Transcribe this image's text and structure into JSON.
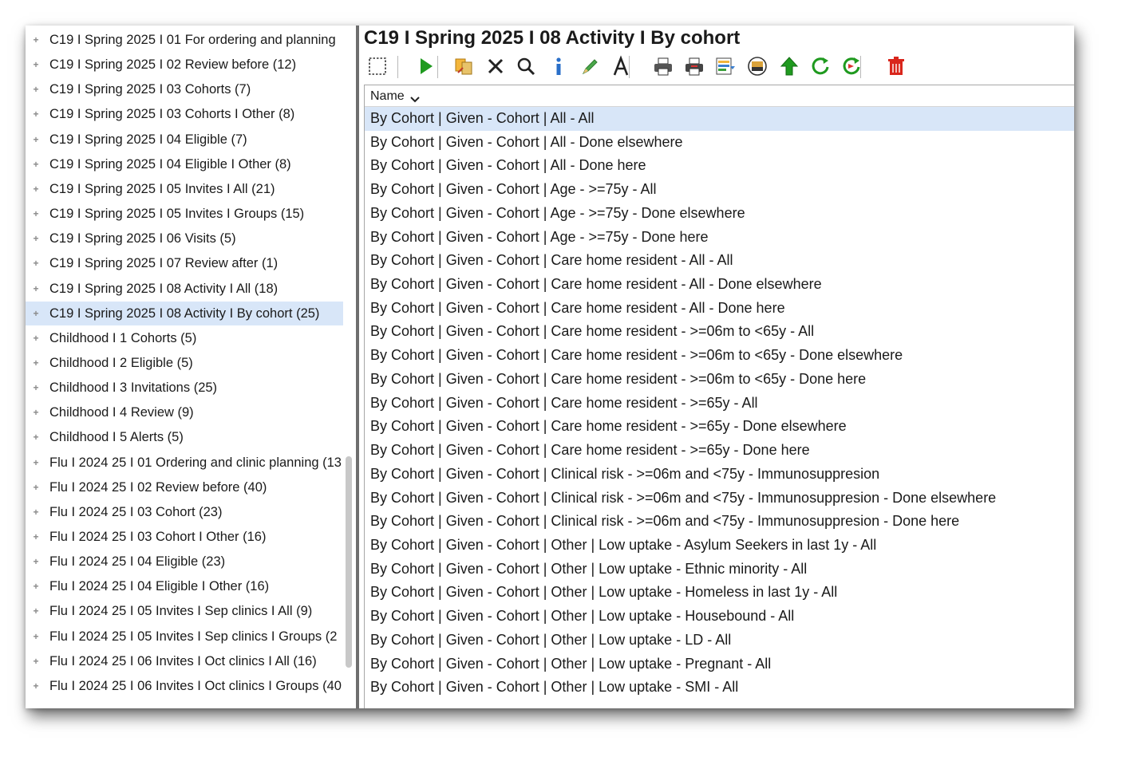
{
  "tree": {
    "items": [
      {
        "label": "C19 I Spring 2025 I 01 For ordering and planning"
      },
      {
        "label": "C19 I Spring 2025 I 02 Review before (12)"
      },
      {
        "label": "C19 I Spring 2025 I 03 Cohorts (7)"
      },
      {
        "label": "C19 I Spring 2025 I 03 Cohorts I Other (8)"
      },
      {
        "label": "C19 I Spring 2025 I 04 Eligible (7)"
      },
      {
        "label": "C19 I Spring 2025 I 04 Eligible I Other (8)"
      },
      {
        "label": "C19 I Spring 2025 I 05 Invites I All (21)"
      },
      {
        "label": "C19 I Spring 2025 I 05 Invites I Groups (15)"
      },
      {
        "label": "C19 I Spring 2025 I 06 Visits (5)"
      },
      {
        "label": "C19 I Spring 2025 I 07 Review after (1)"
      },
      {
        "label": "C19 I Spring 2025 I 08 Activity I All (18)"
      },
      {
        "label": "C19 I Spring 2025 I 08 Activity I By cohort (25)",
        "selected": true
      },
      {
        "label": "Childhood I 1 Cohorts (5)"
      },
      {
        "label": "Childhood I 2 Eligible (5)"
      },
      {
        "label": "Childhood I 3 Invitations (25)"
      },
      {
        "label": "Childhood I 4 Review (9)"
      },
      {
        "label": "Childhood I 5 Alerts (5)"
      },
      {
        "label": "Flu I 2024 25 I 01 Ordering and clinic planning (13"
      },
      {
        "label": "Flu I 2024 25 I 02 Review before (40)"
      },
      {
        "label": "Flu I 2024 25 I 03 Cohort (23)"
      },
      {
        "label": "Flu I 2024 25 I 03 Cohort I Other (16)"
      },
      {
        "label": "Flu I 2024 25 I 04 Eligible (23)"
      },
      {
        "label": "Flu I 2024 25 I 04 Eligible I Other (16)"
      },
      {
        "label": "Flu I 2024 25 I 05 Invites I Sep clinics I All (9)"
      },
      {
        "label": "Flu I 2024 25 I 05 Invites I Sep clinics I Groups (2"
      },
      {
        "label": "Flu I 2024 25 I 06 Invites I Oct clinics I All (16)"
      },
      {
        "label": "Flu I 2024 25 I 06 Invites I Oct clinics I Groups (40"
      }
    ],
    "bullet_glyph": "+"
  },
  "main": {
    "title": "C19 I Spring 2025 I 08 Activity I By cohort",
    "toolbar": [
      {
        "icon": "select-box-icon"
      },
      {
        "icon": "play-icon",
        "color": "#1f9a1f"
      },
      {
        "icon": "copy-move-icon"
      },
      {
        "icon": "close-x-icon"
      },
      {
        "icon": "search-icon"
      },
      {
        "icon": "info-icon",
        "color": "#2a6fc9"
      },
      {
        "icon": "pencil-icon",
        "color": "#4aa84a"
      },
      {
        "icon": "font-icon"
      },
      {
        "icon": "print-icon"
      },
      {
        "icon": "print-preview-icon"
      },
      {
        "icon": "report-icon"
      },
      {
        "icon": "database-icon"
      },
      {
        "icon": "upload-arrow-icon",
        "color": "#1f9a1f"
      },
      {
        "icon": "refresh-icon",
        "color": "#1f9a1f"
      },
      {
        "icon": "refresh-alert-icon"
      },
      {
        "icon": "trash-icon",
        "color": "#d9261c"
      }
    ],
    "list": {
      "header": "Name",
      "rows": [
        {
          "text": "By Cohort | Given - Cohort |  All - All",
          "selected": true
        },
        {
          "text": "By Cohort | Given - Cohort |  All - Done elsewhere"
        },
        {
          "text": "By Cohort | Given - Cohort |  All - Done here"
        },
        {
          "text": "By Cohort | Given - Cohort | Age - >=75y - All"
        },
        {
          "text": "By Cohort | Given - Cohort | Age - >=75y - Done elsewhere"
        },
        {
          "text": "By Cohort | Given - Cohort | Age - >=75y - Done here"
        },
        {
          "text": "By Cohort | Given - Cohort | Care home resident -  All - All"
        },
        {
          "text": "By Cohort | Given - Cohort | Care home resident -  All - Done elsewhere"
        },
        {
          "text": "By Cohort | Given - Cohort | Care home resident -  All - Done here"
        },
        {
          "text": "By Cohort | Given - Cohort | Care home resident - >=06m to <65y - All"
        },
        {
          "text": "By Cohort | Given - Cohort | Care home resident - >=06m to <65y - Done elsewhere"
        },
        {
          "text": "By Cohort | Given - Cohort | Care home resident - >=06m to <65y - Done here"
        },
        {
          "text": "By Cohort | Given - Cohort | Care home resident - >=65y - All"
        },
        {
          "text": "By Cohort | Given - Cohort | Care home resident - >=65y - Done elsewhere"
        },
        {
          "text": "By Cohort | Given - Cohort | Care home resident - >=65y - Done here"
        },
        {
          "text": "By Cohort | Given - Cohort | Clinical risk -  >=06m and <75y - Immunosuppresion"
        },
        {
          "text": "By Cohort | Given - Cohort | Clinical risk -  >=06m and <75y - Immunosuppresion - Done elsewhere"
        },
        {
          "text": "By Cohort | Given - Cohort | Clinical risk -  >=06m and <75y - Immunosuppresion - Done here"
        },
        {
          "text": "By Cohort | Given - Cohort | Other | Low uptake - Asylum Seekers in last 1y - All"
        },
        {
          "text": "By Cohort | Given - Cohort | Other | Low uptake - Ethnic minority - All"
        },
        {
          "text": "By Cohort | Given - Cohort | Other | Low uptake - Homeless in last 1y - All"
        },
        {
          "text": "By Cohort | Given - Cohort | Other | Low uptake - Housebound - All"
        },
        {
          "text": "By Cohort | Given - Cohort | Other | Low uptake - LD - All"
        },
        {
          "text": "By Cohort | Given - Cohort | Other | Low uptake - Pregnant - All"
        },
        {
          "text": "By Cohort | Given - Cohort | Other | Low uptake - SMI - All"
        }
      ]
    }
  },
  "colors": {
    "selection": "#d8e6f8",
    "splitter": "#6e6e6e"
  }
}
